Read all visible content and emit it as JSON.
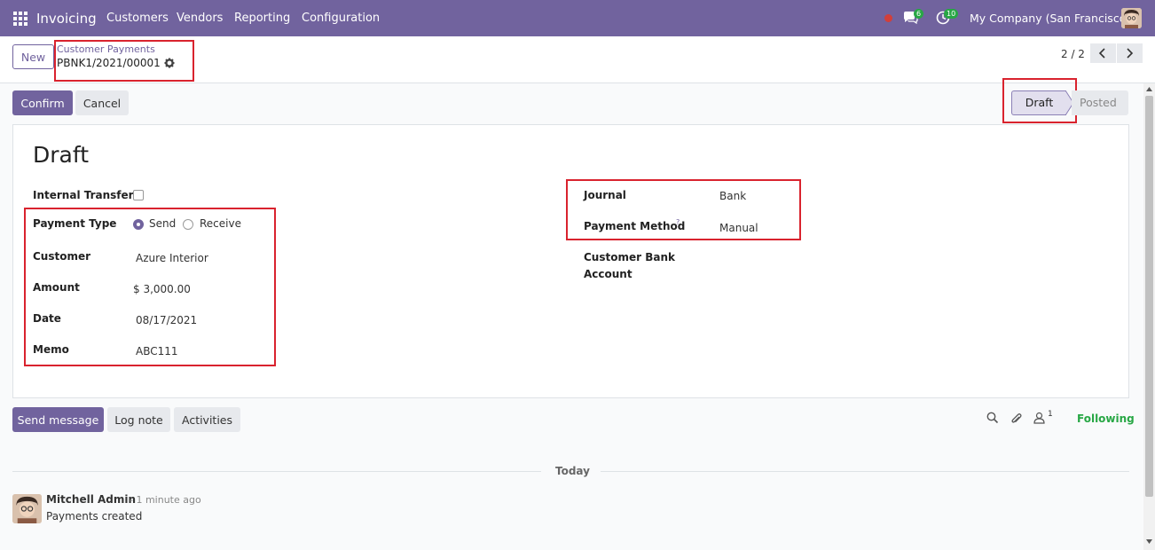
{
  "navbar": {
    "app_name": "Invoicing",
    "menu": [
      "Customers",
      "Vendors",
      "Reporting",
      "Configuration"
    ],
    "messages_count": "6",
    "activities_count": "10",
    "company": "My Company (San Francisco)"
  },
  "control_panel": {
    "new_label": "New",
    "breadcrumb_parent": "Customer Payments",
    "breadcrumb_current": "PBNK1/2021/00001",
    "pager_value": "2 / 2"
  },
  "actions": {
    "confirm_label": "Confirm",
    "cancel_label": "Cancel"
  },
  "statusbar": {
    "stages": [
      "Draft",
      "Posted"
    ],
    "active": "Draft"
  },
  "form": {
    "title": "Draft",
    "internal_transfer_label": "Internal Transfer",
    "payment_type_label": "Payment Type",
    "payment_type_options": [
      "Send",
      "Receive"
    ],
    "payment_type_selected": "Send",
    "customer_label": "Customer",
    "customer_value": "Azure Interior",
    "amount_label": "Amount",
    "amount_value": "$ 3,000.00",
    "date_label": "Date",
    "date_value": "08/17/2021",
    "memo_label": "Memo",
    "memo_value": "ABC111",
    "journal_label": "Journal",
    "journal_value": "Bank",
    "payment_method_label": "Payment Method",
    "payment_method_help": "?",
    "payment_method_value": "Manual",
    "customer_bank_label_1": "Customer Bank",
    "customer_bank_label_2": "Account"
  },
  "chatter": {
    "send_message_label": "Send message",
    "log_note_label": "Log note",
    "activities_label": "Activities",
    "followers_count": "1",
    "following_label": "Following",
    "date_separator": "Today",
    "message": {
      "author": "Mitchell Admin",
      "time": "- 1 minute ago",
      "body": "Payments created"
    }
  },
  "colors": {
    "brand": "#71639e",
    "highlight": "#d9232e",
    "success": "#28a745"
  },
  "icons": [
    "apps-grid-icon",
    "chat-icon",
    "clock-icon",
    "gear-icon",
    "chevron-left-icon",
    "chevron-right-icon",
    "search-icon",
    "paperclip-icon",
    "user-icon"
  ]
}
